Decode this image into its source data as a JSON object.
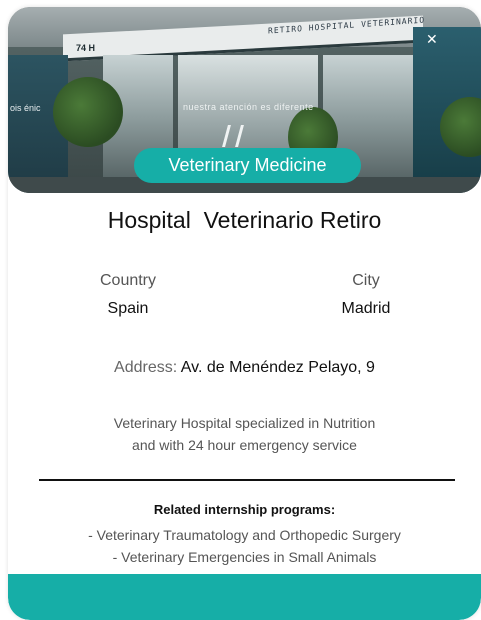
{
  "hero": {
    "sign_text": "RETIRO HOSPITAL VETERINARIO",
    "glass_text": "nuestra atención es diferente",
    "number_text": "74 H",
    "side_text": "ois énic"
  },
  "badge": {
    "label": "Veterinary Medicine"
  },
  "title": "Hospital  Veterinario Retiro",
  "details": {
    "country_label": "Country",
    "country_value": "Spain",
    "city_label": "City",
    "city_value": "Madrid",
    "address_label": "Address:",
    "address_value": "Av. de Menéndez Pelayo, 9"
  },
  "description": {
    "line1": "Veterinary Hospital specialized in Nutrition",
    "line2": "and with 24 hour emergency service"
  },
  "related": {
    "title": "Related internship programs:",
    "programs": [
      "- Veterinary Traumatology and Orthopedic Surgery",
      "- Veterinary Emergencies in Small Animals"
    ]
  },
  "colors": {
    "accent": "#16aea7",
    "title_text": "#111111",
    "muted_text": "#555555"
  }
}
